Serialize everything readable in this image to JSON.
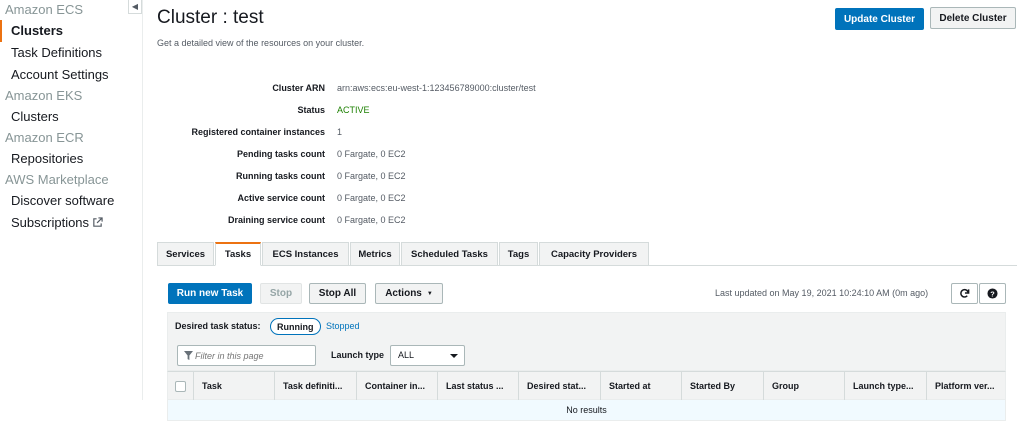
{
  "sidebar": {
    "sections": [
      {
        "title": "Amazon ECS",
        "items": [
          {
            "label": "Clusters",
            "active": true
          },
          {
            "label": "Task Definitions"
          },
          {
            "label": "Account Settings"
          }
        ]
      },
      {
        "title": "Amazon EKS",
        "items": [
          {
            "label": "Clusters"
          }
        ]
      },
      {
        "title": "Amazon ECR",
        "items": [
          {
            "label": "Repositories"
          }
        ]
      },
      {
        "title": "AWS Marketplace",
        "items": [
          {
            "label": "Discover software"
          },
          {
            "label": "Subscriptions"
          }
        ]
      }
    ]
  },
  "header": {
    "title": "Cluster : test",
    "description": "Get a detailed view of the resources on your cluster.",
    "update_button": "Update Cluster",
    "delete_button": "Delete Cluster"
  },
  "details": [
    {
      "label": "Cluster ARN",
      "value": "arn:aws:ecs:eu-west-1:123456789000:cluster/test"
    },
    {
      "label": "Status",
      "value": "ACTIVE"
    },
    {
      "label": "Registered container instances",
      "value": "1"
    },
    {
      "label": "Pending tasks count",
      "value": "0 Fargate, 0 EC2"
    },
    {
      "label": "Running tasks count",
      "value": "0 Fargate, 0 EC2"
    },
    {
      "label": "Active service count",
      "value": "0 Fargate, 0 EC2"
    },
    {
      "label": "Draining service count",
      "value": "0 Fargate, 0 EC2"
    }
  ],
  "tabs": [
    "Services",
    "Tasks",
    "ECS Instances",
    "Metrics",
    "Scheduled Tasks",
    "Tags",
    "Capacity Providers"
  ],
  "active_tab": "Tasks",
  "toolbar": {
    "run_new_task": "Run new Task",
    "stop": "Stop",
    "stop_all": "Stop All",
    "actions": "Actions",
    "last_updated": "Last updated on May 19, 2021 10:24:10 AM (0m ago)"
  },
  "status_filter": {
    "label": "Desired task status:",
    "running": "Running",
    "stopped": "Stopped"
  },
  "filter": {
    "placeholder": "Filter in this page",
    "launch_type_label": "Launch type",
    "launch_type_value": "ALL"
  },
  "table": {
    "columns": [
      "Task",
      "Task definiti...",
      "Container in...",
      "Last status ...",
      "Desired stat...",
      "Started at",
      "Started By",
      "Group",
      "Launch type...",
      "Platform ver..."
    ],
    "empty_message": "No results"
  },
  "colors": {
    "primary": "#0073bb",
    "accent": "#ec7211",
    "active_status": "#1d8102"
  }
}
